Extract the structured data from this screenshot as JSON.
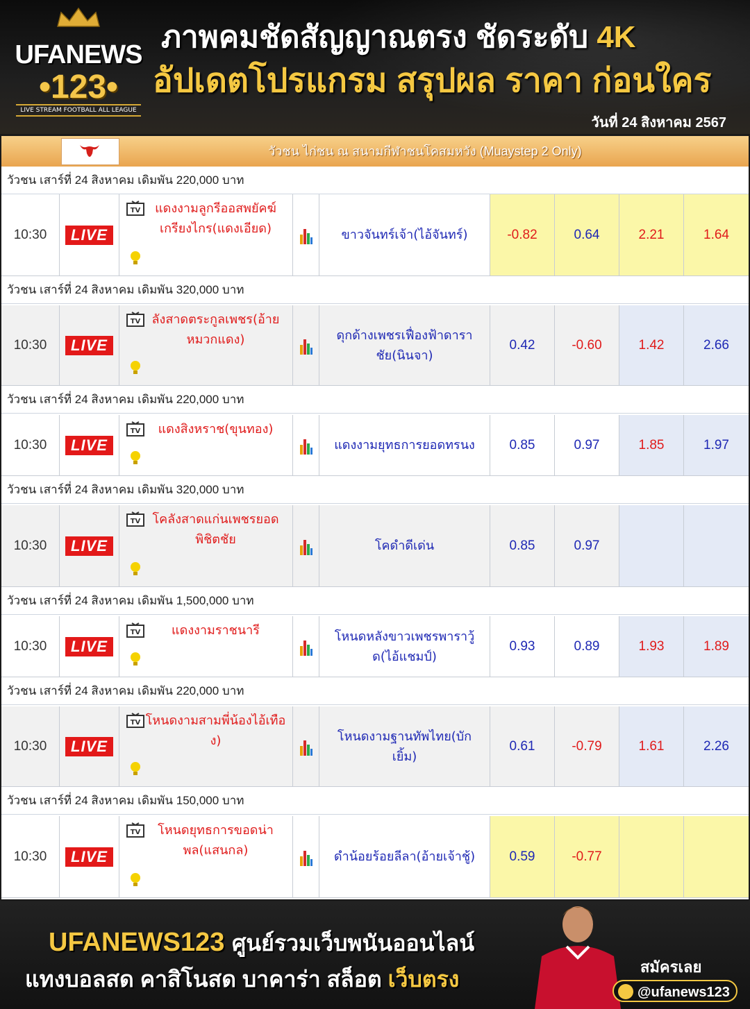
{
  "header": {
    "logo_top": "UFANEWS",
    "logo_num": "•123•",
    "logo_sub": "LIVE STREAM FOOTBALL ALL LEAGUE",
    "line1": "ภาพคมชัดสัญญาณตรง ชัดระดับ",
    "line1_accent": "4K",
    "line2": "อัปเดตโปรแกรม สรุปผล ราคา ก่อนใคร",
    "date": "วันที่ 24 สิงหาคม 2567"
  },
  "board": {
    "title": "วัวชน ไก่ชน ณ สนามกีฬาชนโคสมหวัง (Muaystep 2 Only)",
    "live_label": "LIVE",
    "groups": [
      {
        "label": "วัวชน เสาร์ที่ 24 สิงหาคม เดิมพัน 220,000 บาท"
      },
      {
        "label": "วัวชน เสาร์ที่ 24 สิงหาคม เดิมพัน 320,000 บาท"
      },
      {
        "label": "วัวชน เสาร์ที่ 24 สิงหาคม เดิมพัน 220,000 บาท"
      },
      {
        "label": "วัวชน เสาร์ที่ 24 สิงหาคม เดิมพัน 320,000 บาท"
      },
      {
        "label": "วัวชน เสาร์ที่ 24 สิงหาคม เดิมพัน 1,500,000 บาท"
      },
      {
        "label": "วัวชน เสาร์ที่ 24 สิงหาคม เดิมพัน 220,000 บาท"
      },
      {
        "label": "วัวชน เสาร์ที่ 24 สิงหาคม เดิมพัน 150,000 บาท"
      }
    ],
    "matches": [
      {
        "time": "10:30",
        "home": "แดงงามลูกรีออสพยัคฆ์เกรียงไกร(แดงเอียด)",
        "away": "ขาวจันทร์เจ้า(ไอ้จันทร์)",
        "o1": "-0.82",
        "o2": "0.64",
        "o3": "2.21",
        "o4": "1.64"
      },
      {
        "time": "10:30",
        "home": "ลังสาดตระกูลเพชร(อ้ายหมวกแดง)",
        "away": "ดุกด้างเพชรเฟื่องฟ้าดาราชัย(นินจา)",
        "o1": "0.42",
        "o2": "-0.60",
        "o3": "1.42",
        "o4": "2.66"
      },
      {
        "time": "10:30",
        "home": "แดงสิงหราช(ขุนทอง)",
        "away": "แดงงามยุทธการยอดทรนง",
        "o1": "0.85",
        "o2": "0.97",
        "o3": "1.85",
        "o4": "1.97"
      },
      {
        "time": "10:30",
        "home": "โคลังสาดแก่นเพชรยอดพิชิตชัย",
        "away": "โคดำดีเด่น",
        "o1": "0.85",
        "o2": "0.97",
        "o3": "",
        "o4": ""
      },
      {
        "time": "10:30",
        "home": "แดงงามราชนารี",
        "away": "โหนดหลังขาวเพชรพาราวู้ด(ไอ้แชมป์)",
        "o1": "0.93",
        "o2": "0.89",
        "o3": "1.93",
        "o4": "1.89"
      },
      {
        "time": "10:30",
        "home": "โหนดงามสามพี่น้องไอ้เทือง)",
        "away": "โหนดงามฐานทัพไทย(บักเยิ้ม)",
        "o1": "0.61",
        "o2": "-0.79",
        "o3": "1.61",
        "o4": "2.26"
      },
      {
        "time": "10:30",
        "home": "โหนดยุทธการขอดน่าพล(แสนกล)",
        "away": "ดำน้อยร้อยลีลา(อ้ายเจ้าชู้)",
        "o1": "0.59",
        "o2": "-0.77",
        "o3": "",
        "o4": ""
      }
    ]
  },
  "footer": {
    "brand": "UFANEWS123",
    "tagline": "ศูนย์รวมเว็บพนันออนไลน์",
    "line2": "แทงบอลสด คาสิโนสด บาคาร่า สล็อต",
    "line2_accent": "เว็บตรง",
    "register": "สมัครเลย",
    "line_id": "@ufanews123"
  },
  "colors": {
    "accent": "#f5c842",
    "negative": "#e01b1b",
    "positive": "#1e28b4",
    "live": "#e31919"
  }
}
